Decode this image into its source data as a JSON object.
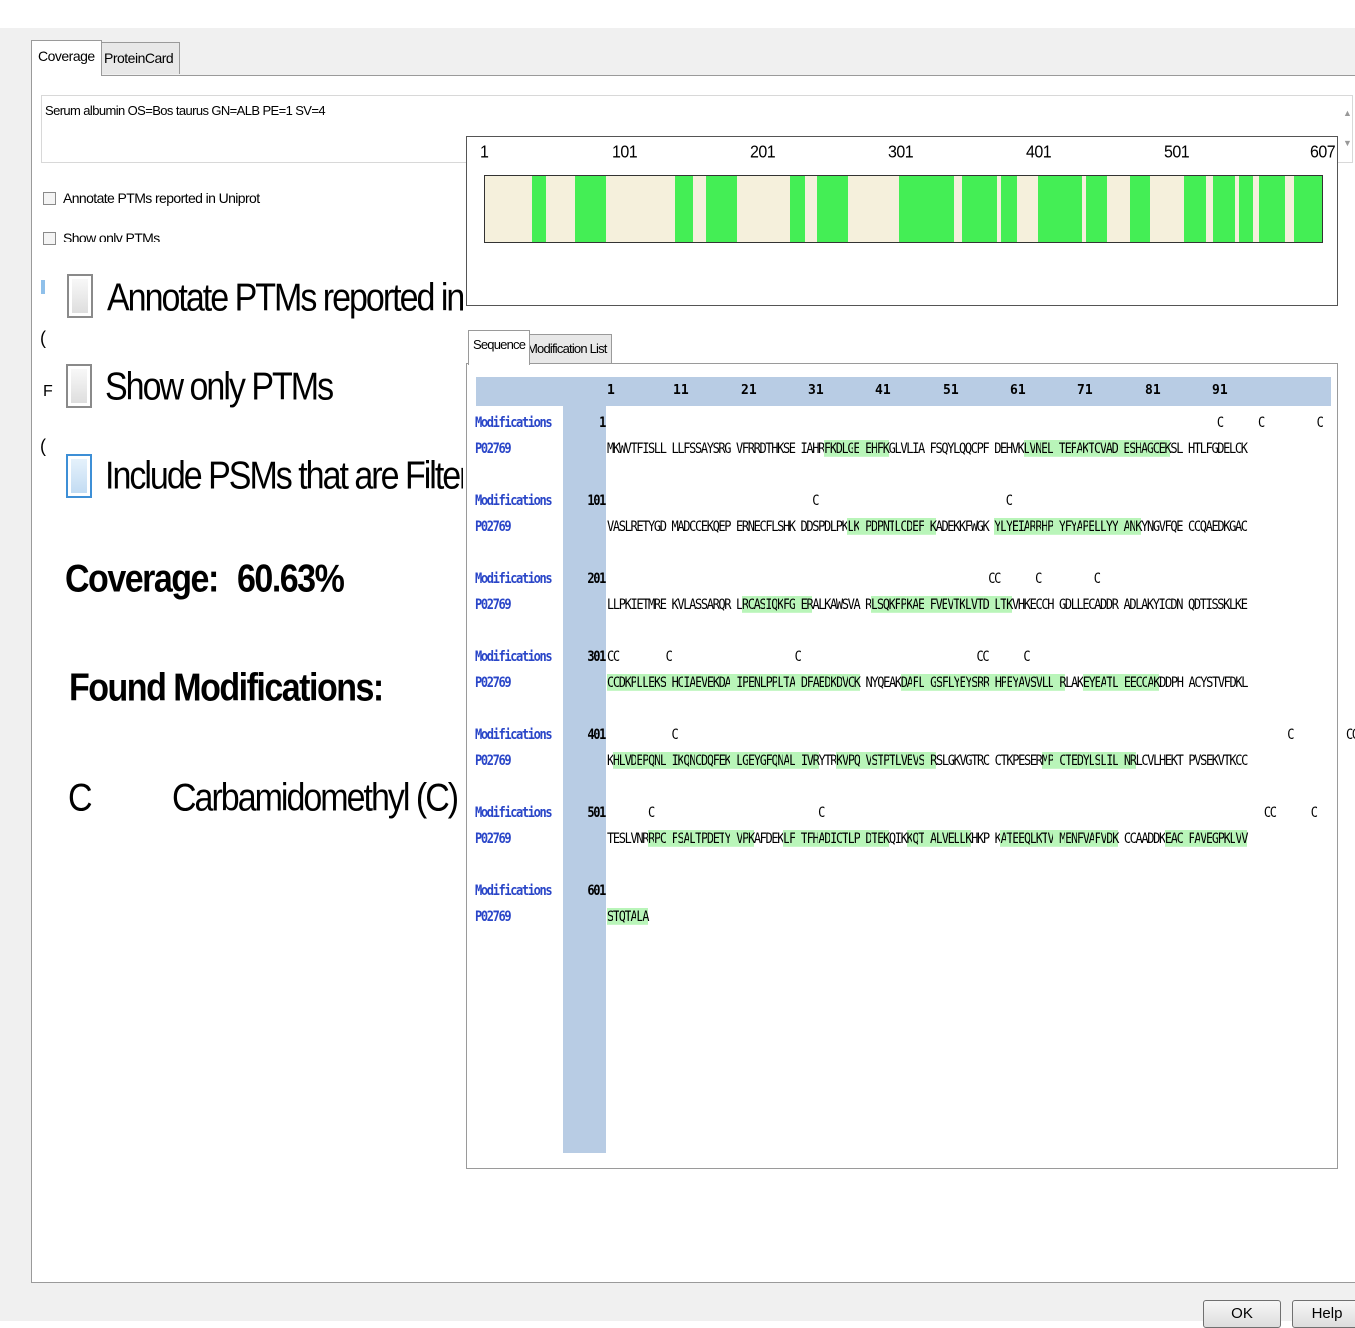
{
  "tabs": [
    "Coverage",
    "ProteinCard"
  ],
  "protein_description": "Serum albumin OS=Bos taurus GN=ALB PE=1 SV=4",
  "options_small": {
    "annotate_label": "Annotate PTMs reported in Uniprot",
    "show_only_label": "Show only PTMs"
  },
  "options_zoomed": {
    "annotate_label": "Annotate PTMs reported in Unipro",
    "show_only_label": "Show only PTMs",
    "include_label": "Include PSMs that are Filtered Out"
  },
  "coverage": {
    "label": "Coverage:",
    "value": "60.63%"
  },
  "found_modifications": {
    "title": "Found Modifications:",
    "items": [
      {
        "symbol": "C",
        "name": "Carbamidomethyl (C)"
      }
    ]
  },
  "coverage_map": {
    "length": 607,
    "tick_labels": [
      "1",
      "101",
      "201",
      "301",
      "401",
      "501",
      "607"
    ],
    "covered_color": "#44ee55",
    "uncovered_color": "#f5f0dc",
    "covered_fraction": 0.6063
  },
  "sequence_tabs": [
    "Sequence",
    "Modification List"
  ],
  "ruler_ticks": [
    "1",
    "11",
    "21",
    "31",
    "41",
    "51",
    "61",
    "71",
    "81",
    "91"
  ],
  "row_labels": {
    "modifications": "Modifications",
    "accession": "P02769"
  },
  "sequence_rows": [
    {
      "index": "1",
      "mods": "                                                                                                        C      C         C",
      "seq": "MKWVTFISLL LLFSSAYSRG VFRRDTHKSE IAHRFKDLGE EHFKGLVLIA FSQYLQQCPF DEHVKLVNEL TEFAKTCVAD ESHAGCEKSL HTLFGDELCK"
    },
    {
      "index": "101",
      "mods": "                                   C                                C",
      "seq": "VASLRETYGD MADCCEKQEP ERNECFLSHK DDSPDLPKLK PDPNTLCDEF KADEKKFWGK YLYEIARRHP YFYAPELLYY ANKYNGVFQE CCQAEDKGAC"
    },
    {
      "index": "201",
      "mods": "                                                                 CC      C         C",
      "seq": "LLPKIETMRE KVLASSARQR LRCASIQKFG ERALKAWSVA RLSQKFPKAE FVEVTKLVTD LTKVHKECCH GDLLECADDR ADLAKYICDN QDTISSKLKE"
    },
    {
      "index": "301",
      "mods": "CC        C                     C                              CC      C",
      "seq": "CCDKPLLEKS HCIAEVEKDA IPENLPPLTA DFAEDKDVCK NYQEAKDAFL GSFLYEYSRR HPEYAVSVLL RLAKEYEATL EECCAKDDPH ACYSTVFDKL"
    },
    {
      "index": "401",
      "mods": "           C                                                                                                        C         CC",
      "seq": "KHLVDEPQNL IKQNCDQFEK LGEYGFQNAL IVRYTRKVPQ VSTPTLVEVS RSLGKVGTRC CTKPESERMP CTEDYLSLIL NRLCVLHEKT PVSEKVTKCC"
    },
    {
      "index": "501",
      "mods": "       C                            C                                                                           CC      C",
      "seq": "TESLVNRRPC FSALTPDETY VPKAFDEKLF TFHADICTLP DTEKQIKKQT ALVELLKHKP KATEEQLKTV MENFVAFVDK CCAADDKEAC FAVEGPKLVV"
    },
    {
      "index": "601",
      "mods": "",
      "seq": "STQTALA"
    }
  ],
  "buttons": {
    "ok": "OK",
    "help": "Help"
  }
}
